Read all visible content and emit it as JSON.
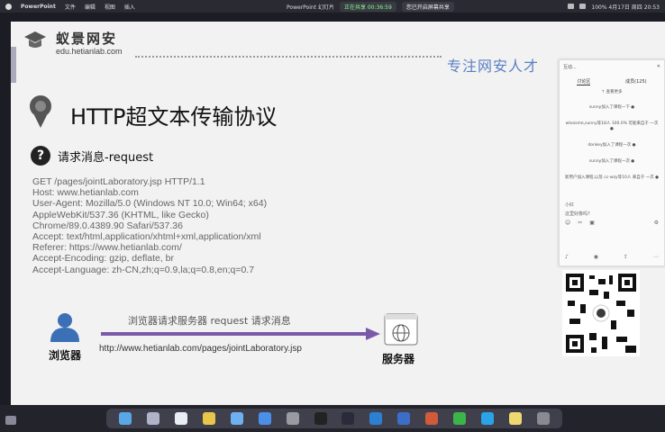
{
  "menubar": {
    "app": "PowerPoint",
    "menus": [
      "文件",
      "编辑",
      "视图",
      "插入"
    ],
    "center_items": [
      "PowerPoint 幻灯片",
      "正在共享 00:36:59",
      "您已开启屏幕共享"
    ],
    "right_text": "100%  4月17日 周四  20:53"
  },
  "slide": {
    "logo_name": "蚁景网安",
    "logo_url": "edu.hetianlab.com",
    "slogan": "专注网安人才",
    "title": "HTTP超文本传输协议",
    "subtitle": "请求消息-request",
    "request_lines": [
      "GET /pages/jointLaboratory.jsp HTTP/1.1",
      "Host: www.hetianlab.com",
      "User-Agent: Mozilla/5.0 (Windows NT 10.0; Win64; x64)",
      "AppleWebKit/537.36 (KHTML, like Gecko)",
      "Chrome/89.0.4389.90 Safari/537.36",
      "Accept: text/html,application/xhtml+xml,application/xml",
      "Referer: https://www.hetianlab.com/",
      "Accept-Encoding: gzip, deflate, br",
      "Accept-Language: zh-CN,zh;q=0.9,la;q=0.8,en;q=0.7"
    ],
    "browser_label": "浏览器",
    "arrow_text": "浏览器请求服务器   request    请求消息",
    "url": "http://www.hetianlab.com/pages/jointLaboratory.jsp",
    "server_label": "服务器"
  },
  "chat": {
    "title": "互动...",
    "tabs": [
      "讨论区",
      "成员(125)"
    ],
    "top_button": "↑ 查看更多",
    "messages": [
      "sunny加入了课程一下 ●",
      "whoisme,sunny等18人 100.0% 可能来自于 一次 ●",
      "donkey加入了课程一次 ●",
      "sunny加入了课程一次 ●",
      "新用户加入课程,以及 cc-wzy等10人 来自于 一次 ●"
    ],
    "poll_label": "小红",
    "poll_question": "这里好像吗?",
    "colors": {
      "accent": "#5a7fc2"
    }
  },
  "dock": {
    "icons": [
      "finder-icon",
      "launchpad-icon",
      "safari-icon",
      "chrome-icon",
      "mail-icon",
      "appstore-icon",
      "settings-icon",
      "terminal-icon",
      "music-icon",
      "vscode-icon",
      "word-icon",
      "ppt-icon",
      "wechat-icon",
      "qq-icon",
      "notes-icon",
      "trash-icon"
    ]
  }
}
